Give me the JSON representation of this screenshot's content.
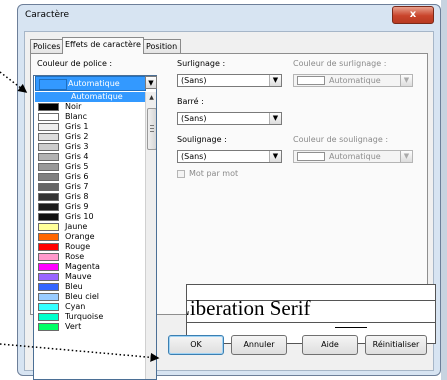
{
  "window": {
    "title": "Caractère",
    "close_glyph": "x"
  },
  "tabs": [
    {
      "label": "Polices",
      "active": false
    },
    {
      "label": "Effets de caractère",
      "active": true
    },
    {
      "label": "Position",
      "active": false
    }
  ],
  "font_color": {
    "label": "Couleur de police :",
    "value": "Automatique"
  },
  "overline": {
    "label": "Surlignage :",
    "value": "(Sans)"
  },
  "overline_color": {
    "label": "Couleur de surlignage :",
    "value": "Automatique",
    "enabled": false
  },
  "strikethrough": {
    "label": "Barré :",
    "value": "(Sans)"
  },
  "underline": {
    "label": "Soulignage :",
    "value": "(Sans)"
  },
  "underline_color": {
    "label": "Couleur de soulignage :",
    "value": "Automatique",
    "enabled": false
  },
  "word_by_word": {
    "label": "Mot par mot",
    "checked": false,
    "enabled": false
  },
  "preview": {
    "text": "Liberation Serif"
  },
  "buttons": {
    "ok": "OK",
    "cancel": "Annuler",
    "help": "Aide",
    "reset": "Réinitialiser"
  },
  "color_list": {
    "selected": "Automatique",
    "items": [
      {
        "name": "Automatique",
        "color": "#3399ff",
        "selected": true
      },
      {
        "name": "Noir",
        "color": "#000000"
      },
      {
        "name": "Blanc",
        "color": "#ffffff"
      },
      {
        "name": "Gris 1",
        "color": "#eeeeee"
      },
      {
        "name": "Gris 2",
        "color": "#dddddd"
      },
      {
        "name": "Gris 3",
        "color": "#cccccc"
      },
      {
        "name": "Gris 4",
        "color": "#b2b2b2"
      },
      {
        "name": "Gris 5",
        "color": "#999999"
      },
      {
        "name": "Gris 6",
        "color": "#808080"
      },
      {
        "name": "Gris 7",
        "color": "#666666"
      },
      {
        "name": "Gris 8",
        "color": "#333333"
      },
      {
        "name": "Gris 9",
        "color": "#1c1c1c"
      },
      {
        "name": "Gris 10",
        "color": "#111111"
      },
      {
        "name": "Jaune",
        "color": "#ffff99"
      },
      {
        "name": "Orange",
        "color": "#ff6600"
      },
      {
        "name": "Rouge",
        "color": "#ff0000"
      },
      {
        "name": "Rose",
        "color": "#ff99cc"
      },
      {
        "name": "Magenta",
        "color": "#ff00ff"
      },
      {
        "name": "Mauve",
        "color": "#9966ff"
      },
      {
        "name": "Bleu",
        "color": "#3366ff"
      },
      {
        "name": "Bleu ciel",
        "color": "#99ccff"
      },
      {
        "name": "Cyan",
        "color": "#33ffff"
      },
      {
        "name": "Turquoise",
        "color": "#00ffcc"
      },
      {
        "name": "Vert",
        "color": "#00ff66"
      }
    ]
  }
}
